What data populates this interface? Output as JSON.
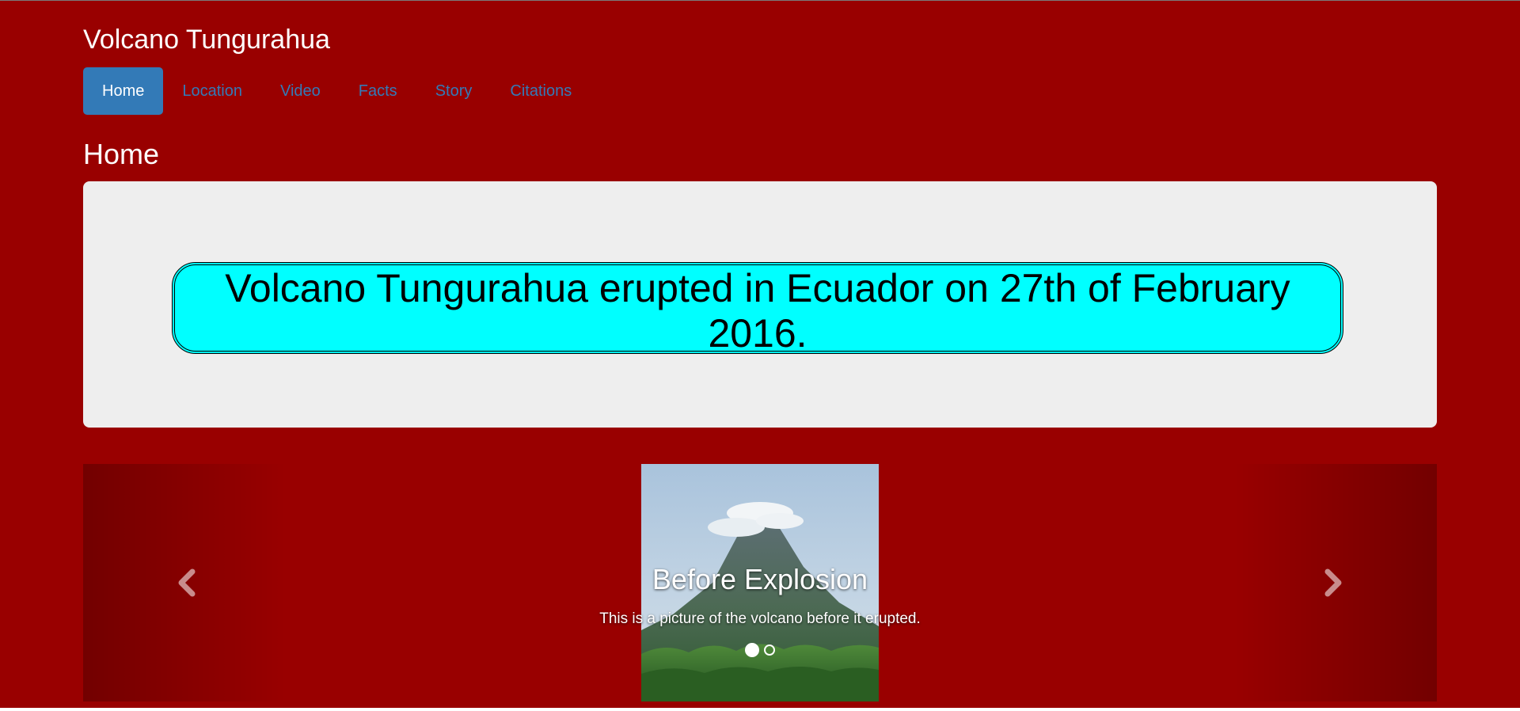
{
  "site": {
    "title": "Volcano Tungurahua"
  },
  "nav": {
    "items": [
      {
        "label": "Home",
        "active": true
      },
      {
        "label": "Location",
        "active": false
      },
      {
        "label": "Video",
        "active": false
      },
      {
        "label": "Facts",
        "active": false
      },
      {
        "label": "Story",
        "active": false
      },
      {
        "label": "Citations",
        "active": false
      }
    ]
  },
  "page": {
    "heading": "Home"
  },
  "jumbotron": {
    "announcement": "Volcano Tungurahua erupted in Ecuador on 27th of February 2016."
  },
  "carousel": {
    "caption_title": "Before Explosion",
    "caption_text": "This is a picture of the volcano before it erupted.",
    "slide_count": 2,
    "active_index": 0,
    "prev_icon": "chevron-left-icon",
    "next_icon": "chevron-right-icon"
  },
  "colors": {
    "background": "#990000",
    "nav_active": "#337ab7",
    "nav_link": "#337ab7",
    "jumbotron": "#eeeeee",
    "announcement_bg": "#00ffff"
  }
}
